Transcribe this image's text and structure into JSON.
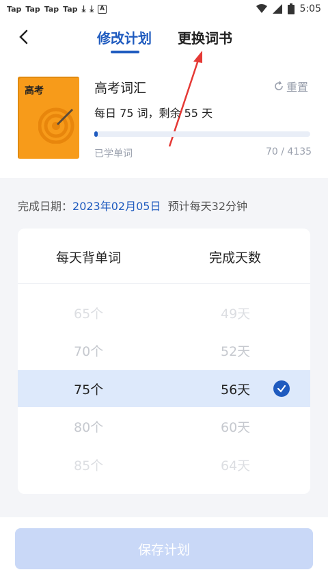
{
  "status": {
    "apps": [
      "Tap",
      "Tap",
      "Tap",
      "Tap"
    ],
    "time": "5:05"
  },
  "header": {
    "tab_modify": "修改计划",
    "tab_change": "更换词书"
  },
  "book": {
    "cover_label": "高考",
    "title": "高考词汇",
    "reset_label": "重置",
    "daily": "每日 75 词，剩余 55 天",
    "progress_fraction": 0.017,
    "learned_label": "已学单词",
    "count": "70 / 4135"
  },
  "plan": {
    "completion_label": "完成日期：",
    "completion_date": "2023年02月05日",
    "estimate": "预计每天32分钟"
  },
  "selector": {
    "header_words": "每天背单词",
    "header_days": "完成天数",
    "rows": [
      {
        "words": "65个",
        "days": "49天"
      },
      {
        "words": "70个",
        "days": "52天"
      },
      {
        "words": "75个",
        "days": "56天"
      },
      {
        "words": "80个",
        "days": "60天"
      },
      {
        "words": "85个",
        "days": "64天"
      }
    ]
  },
  "footer": {
    "save_label": "保存计划"
  },
  "colors": {
    "accent": "#1f5bbf",
    "book_orange": "#f79b1a",
    "selected_row": "#dde9fb",
    "save_disabled": "#c9d8f7"
  }
}
